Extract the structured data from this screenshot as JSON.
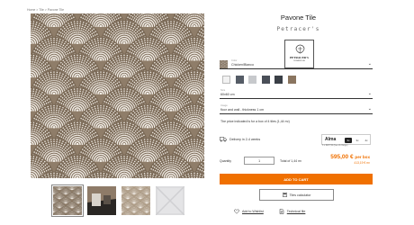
{
  "breadcrumb": "Home > Tile > Pavone Tile",
  "product": {
    "title": "Pavone Tile",
    "brand": "Petracer's",
    "logo_text": "PETRACER'S",
    "logo_sub": "CERAMICHE"
  },
  "color_selector": {
    "label": "Color",
    "value": "Chicken/Bianco"
  },
  "swatches": [
    "#f2f2f2",
    "#555c66",
    "#c7c9cc",
    "#4a4f58",
    "#3a3f46",
    "#8a7560"
  ],
  "size_selector": {
    "label": "Size",
    "value": "60x60 cm"
  },
  "use_selector": {
    "label": "Usage",
    "value": "floor and wall - thickness 1 cm"
  },
  "price_note": "The price indicated is for a box of 4 tiles (1,44 m²)",
  "delivery": "Delivery in 2-4 weeks",
  "alma": {
    "logo": "Alma",
    "options": [
      "3x",
      "3x",
      "4x"
    ],
    "selected_index": 0,
    "detail": "3 x €297,50 (free of charge)"
  },
  "price": {
    "amount": "595,00 €",
    "unit": "per box",
    "per_m2": "413,19 € m²"
  },
  "quantity": {
    "label": "Quantity",
    "value": "1",
    "total": "Total of 1,44 m²"
  },
  "add_to_cart": "ADD TO CART",
  "tiles_calculator": "Tiles calculator",
  "links": {
    "wishlist": "Add to Wishlist",
    "technical": "Technical file"
  },
  "colors": {
    "accent": "#f07000",
    "tile_brown": "#9b8a77"
  }
}
